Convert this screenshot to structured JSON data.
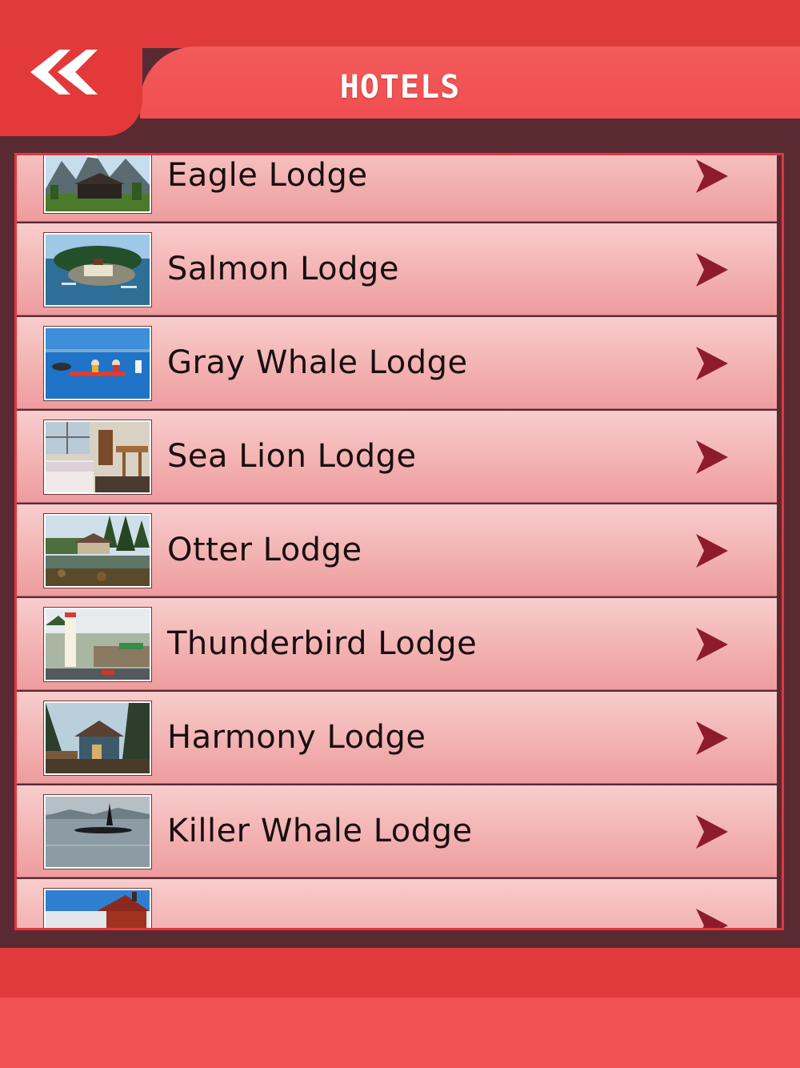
{
  "header": {
    "title": "HOTELS",
    "back_icon": "double-chevron-left-icon"
  },
  "colors": {
    "header_red": "#e13a3c",
    "title_bar_red": "#f04f51",
    "frame_maroon": "#5a2a33",
    "row_pink_light": "#f8cdcd",
    "row_pink_dark": "#ee9c9e",
    "chevron_color": "#8e1b2c"
  },
  "hotels": [
    {
      "name": "Eagle Lodge",
      "thumb_icon": "mountain-lodge-photo"
    },
    {
      "name": "Salmon Lodge",
      "thumb_icon": "island-lodge-photo"
    },
    {
      "name": "Gray Whale Lodge",
      "thumb_icon": "kayak-whale-photo"
    },
    {
      "name": "Sea Lion Lodge",
      "thumb_icon": "hotel-room-photo"
    },
    {
      "name": "Otter Lodge",
      "thumb_icon": "waterfront-cabin-photo"
    },
    {
      "name": "Thunderbird Lodge",
      "thumb_icon": "lodge-sign-photo"
    },
    {
      "name": "Harmony Lodge",
      "thumb_icon": "forest-cabin-photo"
    },
    {
      "name": "Killer Whale Lodge",
      "thumb_icon": "orca-photo"
    },
    {
      "name": "",
      "thumb_icon": "red-cabin-photo"
    }
  ]
}
